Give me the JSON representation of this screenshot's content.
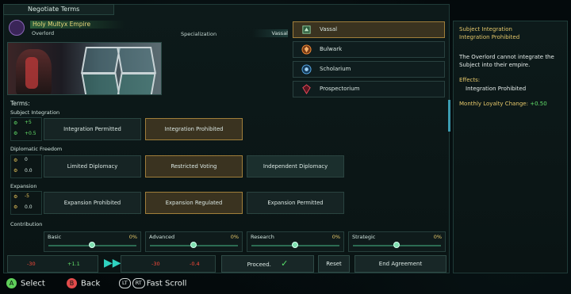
{
  "window": {
    "title": "Negotiate Terms"
  },
  "empire": {
    "name": "Holy Multyx Empire",
    "role": "Overlord",
    "spec_label": "Specialization",
    "spec_value": "Vassal"
  },
  "subject_types": [
    {
      "label": "Vassal",
      "icon": "vassal-icon",
      "selected": true
    },
    {
      "label": "Bulwark",
      "icon": "bulwark-icon",
      "selected": false
    },
    {
      "label": "Scholarium",
      "icon": "scholarium-icon",
      "selected": false
    },
    {
      "label": "Prospectorium",
      "icon": "prospectorium-icon",
      "selected": false
    }
  ],
  "terms": {
    "heading": "Terms:",
    "subject_integration": {
      "title": "Subject Integration",
      "stat1": "+5",
      "stat2": "+0.5",
      "options": [
        "Integration Permitted",
        "Integration Prohibited"
      ]
    },
    "diplomatic_freedom": {
      "title": "Diplomatic Freedom",
      "stat1": "0",
      "stat2": "0.0",
      "options": [
        "Limited Diplomacy",
        "Restricted Voting",
        "Independent Diplomacy"
      ]
    },
    "expansion": {
      "title": "Expansion",
      "stat1": "-5",
      "stat2": "0.0",
      "options": [
        "Expansion Prohibited",
        "Expansion Regulated",
        "Expansion Permitted"
      ]
    },
    "contribution": {
      "title": "Contribution",
      "items": [
        {
          "label": "Basic",
          "pct": "0%",
          "level_pct": 0
        },
        {
          "label": "Advanced",
          "pct": "0%",
          "level_pct": 0
        },
        {
          "label": "Research",
          "pct": "0%",
          "level_pct": 0
        },
        {
          "label": "Strategic",
          "pct": "0%",
          "level_pct": 0
        }
      ]
    }
  },
  "totals": {
    "left_a": "-30",
    "left_b": "+1.1",
    "right_a": "-30",
    "right_b": "-0.4"
  },
  "buttons": {
    "proceed": "Proceed.",
    "reset": "Reset",
    "end": "End Agreement"
  },
  "sidebar": {
    "title1": "Subject Integration",
    "title2": "Integration Prohibited",
    "desc": "The Overlord cannot integrate the Subject into their empire.",
    "effects_label": "Effects:",
    "effect1": "Integration Prohibited",
    "loyalty_label": "Monthly Loyalty Change:",
    "loyalty_value": "+0.50"
  },
  "hints": {
    "a_key": "A",
    "select": "Select",
    "b_key": "B",
    "back": "Back",
    "lt_key": "LT",
    "rt_key": "RT",
    "fast_scroll": "Fast Scroll"
  },
  "colors": {
    "accent_gold": "#e6c86a",
    "selected_border": "#a07e3a",
    "negative": "#ff4a3a",
    "positive": "#63e06a"
  }
}
